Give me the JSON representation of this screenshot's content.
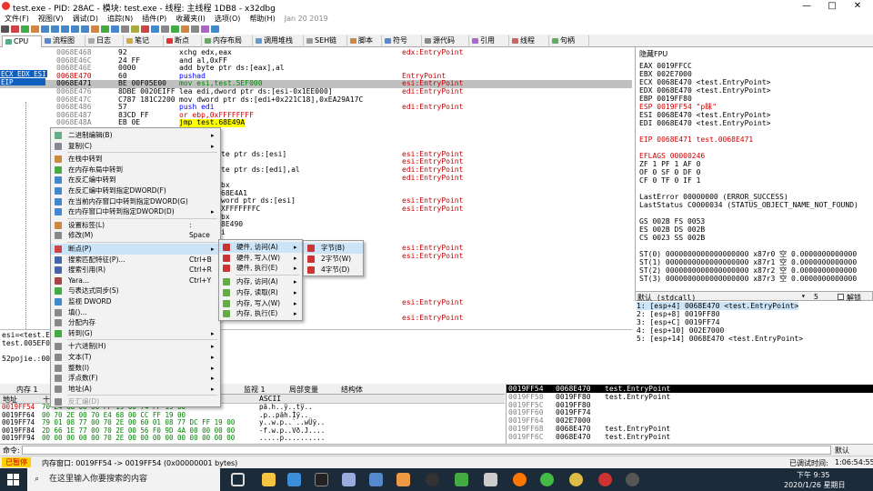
{
  "titlebar": {
    "title": "test.exe - PID: 28AC - 模块: test.exe - 线程: 主线程 1DB8 - x32dbg",
    "minimize": "—",
    "maximize": "□",
    "close": "✕"
  },
  "menus": [
    "文件(F)",
    "视图(V)",
    "调试(D)",
    "追踪(N)",
    "插件(P)",
    "收藏夹(I)",
    "选项(O)",
    "帮助(H)",
    "Jan 20 2019"
  ],
  "tabs": [
    "CPU",
    "流程图",
    "日志",
    "笔记",
    "断点",
    "内存布局",
    "调用堆栈",
    "SEH链",
    "脚本",
    "符号",
    "源代码",
    "引用",
    "线程",
    "句柄"
  ],
  "disasm": [
    {
      "addr": "0068E468",
      "bytes": "92",
      "instr": "xchg edx,eax",
      "cmt": "edx:EntryPoint"
    },
    {
      "addr": "0068E46C",
      "bytes": "24 FF",
      "instr": "and al,0xFF",
      "cmt": ""
    },
    {
      "addr": "0068E46E",
      "bytes": "0000",
      "instr": "add byte ptr ds:[eax],al",
      "cmt": ""
    },
    {
      "addr": "0068E470",
      "bytes": "60",
      "instr": "pushad",
      "cmt": "EntryPoint"
    },
    {
      "addr": "0068E471",
      "bytes": "BE 00F05E00",
      "instr": "mov esi,test.5EF000",
      "cmt": "esi:EntryPoint"
    },
    {
      "addr": "0068E476",
      "bytes": "8DBE 0020EIFF",
      "instr": "lea edi,dword ptr ds:[esi-0x1EE000]",
      "cmt": "edi:EntryPoint"
    },
    {
      "addr": "0068E47C",
      "bytes": "C787 181C2200",
      "instr": "mov dword ptr ds:[edi+0x221C18],0xEA29A17C",
      "cmt": ""
    },
    {
      "addr": "0068E486",
      "bytes": "57",
      "instr": "push edi",
      "cmt": "edi:EntryPoint"
    },
    {
      "addr": "0068E487",
      "bytes": "83CD FF",
      "instr": "or ebp,0xFFFFFFFF",
      "cmt": ""
    },
    {
      "addr": "0068E48A",
      "bytes": "EB 0E",
      "instr": "jmp test.68E49A",
      "cmt": ""
    },
    {
      "addr": "",
      "bytes": "90",
      "instr": "",
      "cmt": ""
    },
    {
      "addr": "",
      "bytes": "",
      "instr": "",
      "cmt": ""
    },
    {
      "addr": "",
      "bytes": "",
      "instr": "",
      "cmt": ""
    },
    {
      "addr": "",
      "bytes": "",
      "instr": "te ptr ds:[esi]",
      "cmt": "esi:EntryPoint"
    },
    {
      "addr": "",
      "bytes": "",
      "instr": "",
      "cmt": "esi:EntryPoint"
    },
    {
      "addr": "",
      "bytes": "",
      "instr": "te ptr ds:[edi],al",
      "cmt": "edi:EntryPoint"
    },
    {
      "addr": "",
      "bytes": "",
      "instr": "",
      "cmt": "edi:EntryPoint"
    },
    {
      "addr": "",
      "bytes": "",
      "instr": "bx",
      "cmt": ""
    },
    {
      "addr": "",
      "bytes": "",
      "instr": "68E4A1",
      "cmt": ""
    },
    {
      "addr": "",
      "bytes": "",
      "instr": "word ptr ds:[esi]",
      "cmt": "esi:EntryPoint"
    },
    {
      "addr": "",
      "bytes": "",
      "instr": "XFFFFFFFC",
      "cmt": "esi:EntryPoint"
    },
    {
      "addr": "",
      "bytes": "",
      "instr": "bx",
      "cmt": ""
    },
    {
      "addr": "",
      "bytes": "",
      "instr": "8E490",
      "cmt": ""
    },
    {
      "addr": "",
      "bytes": "",
      "instr": "i",
      "cmt": ""
    },
    {
      "addr": "",
      "bytes": "",
      "instr": "",
      "cmt": ""
    },
    {
      "addr": "",
      "bytes": "",
      "instr": "",
      "cmt": "esi:EntryPoint"
    },
    {
      "addr": "",
      "bytes": "",
      "instr": "",
      "cmt": "esi:EntryPoint"
    },
    {
      "addr": "",
      "bytes": "",
      "instr": "",
      "cmt": ""
    },
    {
      "addr": "",
      "bytes": "",
      "instr": "",
      "cmt": ""
    },
    {
      "addr": "",
      "bytes": "",
      "instr": "",
      "cmt": ""
    },
    {
      "addr": "",
      "bytes": "",
      "instr": "",
      "cmt": ""
    },
    {
      "addr": "",
      "bytes": "",
      "instr": "",
      "cmt": ""
    },
    {
      "addr": "",
      "bytes": "",
      "instr": "",
      "cmt": "esi:EntryPoint"
    },
    {
      "addr": "",
      "bytes": "",
      "instr": "",
      "cmt": ""
    },
    {
      "addr": "",
      "bytes": "",
      "instr": "",
      "cmt": "esi:EntryPoint"
    }
  ],
  "reg_labels": {
    "ecx_edx_esi": "ECX EDX ESI",
    "eip": "EIP"
  },
  "info": {
    "line1": "esi=<test.E",
    "line2": "test.005EF0",
    "line3": "52pojie.:00"
  },
  "regs": {
    "header": "隐藏FPU",
    "lines": [
      "EAX    0019FFCC",
      "EBX    002E7000",
      "ECX    0068E470    <test.EntryPoint>",
      "EDX    0068E470    <test.EntryPoint>",
      "EBP    0019FF80",
      "ESP    0019FF54    \"p眛\"",
      "ESI    0068E470    <test.EntryPoint>",
      "EDI    0068E470    <test.EntryPoint>",
      "",
      "EIP    0068E471    test.0068E471",
      "",
      "EFLAGS    00000246",
      "ZF 1  PF 1  AF 0",
      "OF 0  SF 0  DF 0",
      "CF 0  TF 0  IF 1",
      "",
      "LastError  00000000 (ERROR_SUCCESS)",
      "LastStatus C0000034 (STATUS_OBJECT_NAME_NOT_FOUND)",
      "",
      "GS 002B  FS 0053",
      "ES 002B  DS 002B",
      "CS 0023  SS 002B",
      "",
      "ST(0) 0000000000000000000 x87r0 空 0.0000000000000",
      "ST(1) 0000000000000000000 x87r1 空 0.0000000000000",
      "ST(2) 0000000000000000000 x87r2 空 0.0000000000000",
      "ST(3) 0000000000000000000 x87r3 空 0.0000000000000"
    ]
  },
  "stackhdr": {
    "conv": "默认 (stdcall)",
    "num": "5",
    "unlock": "解锁"
  },
  "stackargs": [
    "1: [esp+4] 0068E470 <test.EntryPoint>",
    "2: [esp+8] 0019FF80",
    "3: [esp+C] 0019FF74",
    "4: [esp+10] 002E7000",
    "5: [esp+14] 0068E470 <test.EntryPoint>"
  ],
  "bottomtabs": [
    "内存 1",
    "监视 1",
    "局部变量",
    "结构体"
  ],
  "dumphdr": {
    "addr": "地址",
    "hex": "十",
    "ascii": "ASCII"
  },
  "dump": [
    {
      "addr": "0019FF54",
      "hex": "70 E4 68 00  80 FF 19 00  74 FF 19 00",
      "ascii": "pä.h..ÿ..tÿ.."
    },
    {
      "addr": "0019FF64",
      "hex": "00 70 2E 00  70 E4 68 00  CC FF 19 00",
      "ascii": ".p..päh.Ìÿ.."
    },
    {
      "addr": "0019FF74",
      "hex": "79 01 08 77  00 70 2E 00  60 01 08 77  DC FF 19 00",
      "ascii": "y..w.p..`..wÜÿ.."
    },
    {
      "addr": "0019FF84",
      "hex": "2D 66 1E 77  00 70 2E 00  56 F0 9D 4A  00 00 00 00",
      "ascii": "-f.w.p..Vð.J...."
    },
    {
      "addr": "0019FF94",
      "hex": "00 00 00 00  00 70 2E 00  00 00 00 00  00 00 00 00",
      "ascii": ".....p.........."
    }
  ],
  "stack": [
    {
      "addr": "0019FF54",
      "val": "0068E470",
      "cmt": "test.EntryPoint"
    },
    {
      "addr": "0019FF58",
      "val": "0019FF80",
      "cmt": "test.EntryPoint"
    },
    {
      "addr": "0019FF5C",
      "val": "0019FF80",
      "cmt": ""
    },
    {
      "addr": "0019FF60",
      "val": "0019FF74",
      "cmt": ""
    },
    {
      "addr": "0019FF64",
      "val": "002E7000",
      "cmt": ""
    },
    {
      "addr": "0019FF68",
      "val": "0068E470",
      "cmt": "test.EntryPoint"
    },
    {
      "addr": "0019FF6C",
      "val": "0068E470",
      "cmt": "test.EntryPoint"
    }
  ],
  "cmd": {
    "label": "命令:",
    "default": "默认"
  },
  "status": {
    "state": "已暂停",
    "msg": "内存窗口: 0019FF54 -> 0019FF54 (0x00000001 bytes)",
    "time_label": "已调试时间:",
    "time": "1:06:54:55"
  },
  "context_menu": [
    {
      "label": "二进制编辑(B)",
      "sc": "",
      "arrow": true,
      "color": "#6a8"
    },
    {
      "label": "复制(C)",
      "sc": "",
      "arrow": true,
      "color": "#889"
    },
    {
      "label": "在栈中转到",
      "sc": "",
      "arrow": false,
      "color": "#c84"
    },
    {
      "label": "在内存布局中转到",
      "sc": "",
      "arrow": false,
      "color": "#4a4"
    },
    {
      "label": "在反汇编中转到",
      "sc": "",
      "arrow": false,
      "color": "#48c"
    },
    {
      "label": "在反汇编中转到指定DWORD(F)",
      "sc": "",
      "arrow": false,
      "color": "#48c"
    },
    {
      "label": "在当前内存窗口中转到指定DWORD(G)",
      "sc": "",
      "arrow": false,
      "color": "#48c"
    },
    {
      "label": "在内存窗口中转到指定DWORD(D)",
      "sc": "",
      "arrow": true,
      "color": "#48c"
    },
    {
      "label": "设置标签(L)",
      "sc": ":",
      "arrow": false,
      "color": "#c84"
    },
    {
      "label": "修改(M)",
      "sc": "Space",
      "arrow": false,
      "color": "#888"
    },
    {
      "label": "断点(P)",
      "sc": "",
      "arrow": true,
      "color": "#c44",
      "hot": true
    },
    {
      "label": "搜索匹配特征(P)...",
      "sc": "Ctrl+B",
      "arrow": false,
      "color": "#46a"
    },
    {
      "label": "搜索引用(R)",
      "sc": "Ctrl+R",
      "arrow": false,
      "color": "#46a"
    },
    {
      "label": "Yara...",
      "sc": "Ctrl+Y",
      "arrow": false,
      "color": "#a44"
    },
    {
      "label": "与表达式同步(S)",
      "sc": "",
      "arrow": false,
      "color": "#4a4"
    },
    {
      "label": "监视 DWORD",
      "sc": "",
      "arrow": false,
      "color": "#48c"
    },
    {
      "label": "填()...",
      "sc": "",
      "arrow": false,
      "color": "#888"
    },
    {
      "label": "分配内存",
      "sc": "",
      "arrow": false,
      "color": "#888"
    },
    {
      "label": "转到(G)",
      "sc": "",
      "arrow": true,
      "color": "#4a4"
    },
    {
      "label": "十六进制(H)",
      "sc": "",
      "arrow": true,
      "color": "#888"
    },
    {
      "label": "文本(T)",
      "sc": "",
      "arrow": true,
      "color": "#888"
    },
    {
      "label": "整数(I)",
      "sc": "",
      "arrow": true,
      "color": "#888"
    },
    {
      "label": "浮点数(F)",
      "sc": "",
      "arrow": true,
      "color": "#888"
    },
    {
      "label": "地址(A)",
      "sc": "",
      "arrow": true,
      "color": "#888"
    },
    {
      "label": "反汇编(D)",
      "sc": "",
      "arrow": false,
      "color": "#888"
    }
  ],
  "submenu_bp": [
    {
      "label": "硬件, 访问(A)",
      "hot": true
    },
    {
      "label": "硬件, 写入(W)"
    },
    {
      "label": "硬件, 执行(E)"
    },
    {
      "label": "内存, 访问(A)"
    },
    {
      "label": "内存, 读取(R)"
    },
    {
      "label": "内存, 写入(W)"
    },
    {
      "label": "内存, 执行(E)"
    }
  ],
  "submenu_hw": [
    "字节(B)",
    "2字节(W)",
    "4字节(D)"
  ],
  "taskbar": {
    "search": "在这里输入你要搜索的内容",
    "time": "下午 9:35",
    "date": "2020/1/26 星期日"
  }
}
